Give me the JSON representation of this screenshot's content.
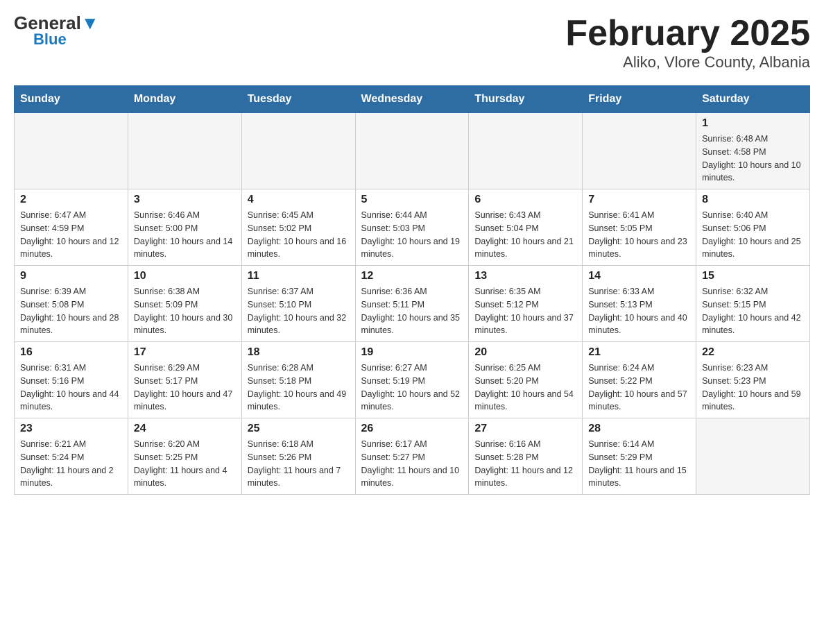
{
  "logo": {
    "general": "General",
    "blue": "Blue",
    "arrow": "▲"
  },
  "title": "February 2025",
  "subtitle": "Aliko, Vlore County, Albania",
  "days_of_week": [
    "Sunday",
    "Monday",
    "Tuesday",
    "Wednesday",
    "Thursday",
    "Friday",
    "Saturday"
  ],
  "weeks": [
    [
      {
        "day": "",
        "info": ""
      },
      {
        "day": "",
        "info": ""
      },
      {
        "day": "",
        "info": ""
      },
      {
        "day": "",
        "info": ""
      },
      {
        "day": "",
        "info": ""
      },
      {
        "day": "",
        "info": ""
      },
      {
        "day": "1",
        "info": "Sunrise: 6:48 AM\nSunset: 4:58 PM\nDaylight: 10 hours and 10 minutes."
      }
    ],
    [
      {
        "day": "2",
        "info": "Sunrise: 6:47 AM\nSunset: 4:59 PM\nDaylight: 10 hours and 12 minutes."
      },
      {
        "day": "3",
        "info": "Sunrise: 6:46 AM\nSunset: 5:00 PM\nDaylight: 10 hours and 14 minutes."
      },
      {
        "day": "4",
        "info": "Sunrise: 6:45 AM\nSunset: 5:02 PM\nDaylight: 10 hours and 16 minutes."
      },
      {
        "day": "5",
        "info": "Sunrise: 6:44 AM\nSunset: 5:03 PM\nDaylight: 10 hours and 19 minutes."
      },
      {
        "day": "6",
        "info": "Sunrise: 6:43 AM\nSunset: 5:04 PM\nDaylight: 10 hours and 21 minutes."
      },
      {
        "day": "7",
        "info": "Sunrise: 6:41 AM\nSunset: 5:05 PM\nDaylight: 10 hours and 23 minutes."
      },
      {
        "day": "8",
        "info": "Sunrise: 6:40 AM\nSunset: 5:06 PM\nDaylight: 10 hours and 25 minutes."
      }
    ],
    [
      {
        "day": "9",
        "info": "Sunrise: 6:39 AM\nSunset: 5:08 PM\nDaylight: 10 hours and 28 minutes."
      },
      {
        "day": "10",
        "info": "Sunrise: 6:38 AM\nSunset: 5:09 PM\nDaylight: 10 hours and 30 minutes."
      },
      {
        "day": "11",
        "info": "Sunrise: 6:37 AM\nSunset: 5:10 PM\nDaylight: 10 hours and 32 minutes."
      },
      {
        "day": "12",
        "info": "Sunrise: 6:36 AM\nSunset: 5:11 PM\nDaylight: 10 hours and 35 minutes."
      },
      {
        "day": "13",
        "info": "Sunrise: 6:35 AM\nSunset: 5:12 PM\nDaylight: 10 hours and 37 minutes."
      },
      {
        "day": "14",
        "info": "Sunrise: 6:33 AM\nSunset: 5:13 PM\nDaylight: 10 hours and 40 minutes."
      },
      {
        "day": "15",
        "info": "Sunrise: 6:32 AM\nSunset: 5:15 PM\nDaylight: 10 hours and 42 minutes."
      }
    ],
    [
      {
        "day": "16",
        "info": "Sunrise: 6:31 AM\nSunset: 5:16 PM\nDaylight: 10 hours and 44 minutes."
      },
      {
        "day": "17",
        "info": "Sunrise: 6:29 AM\nSunset: 5:17 PM\nDaylight: 10 hours and 47 minutes."
      },
      {
        "day": "18",
        "info": "Sunrise: 6:28 AM\nSunset: 5:18 PM\nDaylight: 10 hours and 49 minutes."
      },
      {
        "day": "19",
        "info": "Sunrise: 6:27 AM\nSunset: 5:19 PM\nDaylight: 10 hours and 52 minutes."
      },
      {
        "day": "20",
        "info": "Sunrise: 6:25 AM\nSunset: 5:20 PM\nDaylight: 10 hours and 54 minutes."
      },
      {
        "day": "21",
        "info": "Sunrise: 6:24 AM\nSunset: 5:22 PM\nDaylight: 10 hours and 57 minutes."
      },
      {
        "day": "22",
        "info": "Sunrise: 6:23 AM\nSunset: 5:23 PM\nDaylight: 10 hours and 59 minutes."
      }
    ],
    [
      {
        "day": "23",
        "info": "Sunrise: 6:21 AM\nSunset: 5:24 PM\nDaylight: 11 hours and 2 minutes."
      },
      {
        "day": "24",
        "info": "Sunrise: 6:20 AM\nSunset: 5:25 PM\nDaylight: 11 hours and 4 minutes."
      },
      {
        "day": "25",
        "info": "Sunrise: 6:18 AM\nSunset: 5:26 PM\nDaylight: 11 hours and 7 minutes."
      },
      {
        "day": "26",
        "info": "Sunrise: 6:17 AM\nSunset: 5:27 PM\nDaylight: 11 hours and 10 minutes."
      },
      {
        "day": "27",
        "info": "Sunrise: 6:16 AM\nSunset: 5:28 PM\nDaylight: 11 hours and 12 minutes."
      },
      {
        "day": "28",
        "info": "Sunrise: 6:14 AM\nSunset: 5:29 PM\nDaylight: 11 hours and 15 minutes."
      },
      {
        "day": "",
        "info": ""
      }
    ]
  ]
}
